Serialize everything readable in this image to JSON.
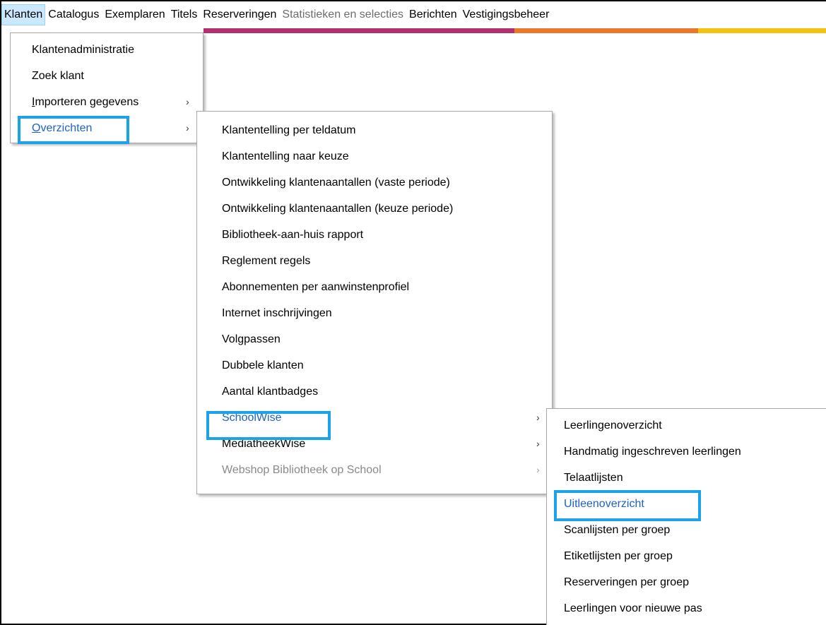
{
  "menubar": {
    "items": [
      {
        "label": "Klanten",
        "active": true,
        "disabled": false
      },
      {
        "label": "Catalogus",
        "active": false,
        "disabled": false
      },
      {
        "label": "Exemplaren",
        "active": false,
        "disabled": false
      },
      {
        "label": "Titels",
        "active": false,
        "disabled": false
      },
      {
        "label": "Reserveringen",
        "active": false,
        "disabled": false
      },
      {
        "label": "Statistieken en selecties",
        "active": false,
        "disabled": true
      },
      {
        "label": "Berichten",
        "active": false,
        "disabled": false
      },
      {
        "label": "Vestigingsbeheer",
        "active": false,
        "disabled": false
      }
    ]
  },
  "accent_colors": {
    "purple": "#b3306f",
    "orange": "#e9782b",
    "yellow": "#f7c112",
    "highlight": "#1aa3e8",
    "selected_text": "#1f62c6"
  },
  "menu_klanten": {
    "items": [
      {
        "label": "Klantenadministratie",
        "submenu": false
      },
      {
        "label": "Zoek klant",
        "submenu": false
      },
      {
        "label": "Importeren gegevens",
        "submenu": true,
        "arrow": "›"
      },
      {
        "label": "Overzichten",
        "submenu": true,
        "arrow": "›",
        "selected": true
      }
    ]
  },
  "menu_overzichten": {
    "items": [
      {
        "label": "Klantentelling per teldatum"
      },
      {
        "label": "Klantentelling naar keuze"
      },
      {
        "label": "Ontwikkeling klantenaantallen (vaste periode)"
      },
      {
        "label": "Ontwikkeling klantenaantallen (keuze periode)"
      },
      {
        "label": "Bibliotheek-aan-huis rapport"
      },
      {
        "label": "Reglement regels"
      },
      {
        "label": "Abonnementen per aanwinstenprofiel"
      },
      {
        "label": "Internet inschrijvingen"
      },
      {
        "label": "Volgpassen"
      },
      {
        "label": "Dubbele klanten"
      },
      {
        "label": "Aantal klantbadges"
      },
      {
        "label": "SchoolWise",
        "arrow": "›",
        "selected": true
      },
      {
        "label": "MediatheekWise",
        "arrow": "›"
      },
      {
        "label": "Webshop Bibliotheek op School",
        "arrow": "›",
        "disabled": true
      }
    ]
  },
  "menu_schoolwise": {
    "items": [
      {
        "label": "Leerlingenoverzicht"
      },
      {
        "label": "Handmatig ingeschreven leerlingen"
      },
      {
        "label": "Telaatlijsten"
      },
      {
        "label": "Uitleenoverzicht",
        "selected": true
      },
      {
        "label": "Scanlijsten per groep"
      },
      {
        "label": "Etiketlijsten per groep"
      },
      {
        "label": "Reserveringen per groep"
      },
      {
        "label": "Leerlingen voor nieuwe pas"
      }
    ]
  }
}
